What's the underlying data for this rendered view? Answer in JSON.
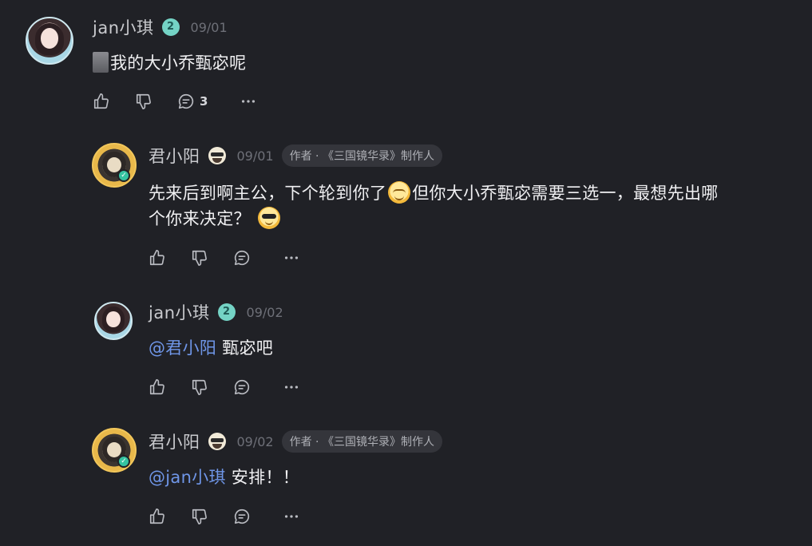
{
  "comments": [
    {
      "user": "jan小琪",
      "level": "2",
      "date": "09/01",
      "text": "我的大小乔甄宓呢",
      "reply_count": "3"
    },
    {
      "user": "君小阳",
      "date": "09/01",
      "author_tag": "作者 · 《三国镜华录》制作人",
      "text_part1": "先来后到啊主公，下个轮到你了",
      "text_part2": "但你大小乔甄宓需要三选一，最想先出哪",
      "text_line2": "个你来决定？"
    },
    {
      "user": "jan小琪",
      "level": "2",
      "date": "09/02",
      "mention": "@君小阳",
      "text": "甄宓吧"
    },
    {
      "user": "君小阳",
      "date": "09/02",
      "author_tag": "作者 · 《三国镜华录》制作人",
      "mention": "@jan小琪",
      "text": "安排！！"
    }
  ],
  "icons": {
    "like": "thumbs-up-icon",
    "dislike": "thumbs-down-icon",
    "reply": "comment-icon",
    "more": "more-icon"
  }
}
